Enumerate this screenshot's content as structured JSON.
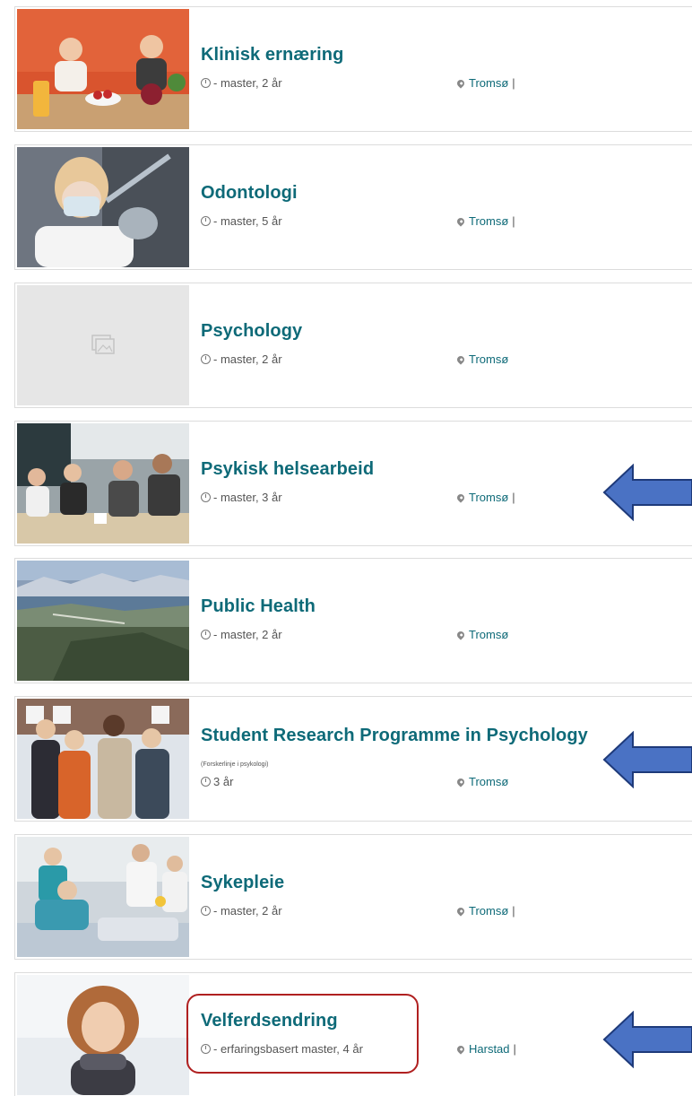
{
  "colors": {
    "title": "#0e6a78",
    "arrow": "#4a72c4",
    "highlight": "#b02020"
  },
  "programs": [
    {
      "title": "Klinisk ernæring",
      "meta": "- master, 2 år",
      "location": "Tromsø",
      "separator": "|"
    },
    {
      "title": "Odontologi",
      "meta": "- master, 5 år",
      "location": "Tromsø",
      "separator": "|"
    },
    {
      "title": "Psychology",
      "meta": "- master, 2 år",
      "location": "Tromsø",
      "separator": ""
    },
    {
      "title": "Psykisk helsearbeid",
      "meta": "- master, 3 år",
      "location": "Tromsø",
      "separator": "|"
    },
    {
      "title": "Public Health",
      "meta": "- master, 2 år",
      "location": "Tromsø",
      "separator": ""
    },
    {
      "title": "Student Research Programme in Psychology",
      "subtitle": "(Forskerlinje i psykologi)",
      "meta": "3 år",
      "location": "Tromsø",
      "separator": ""
    },
    {
      "title": "Sykepleie",
      "meta": "- master, 2 år",
      "location": "Tromsø",
      "separator": "|"
    },
    {
      "title": "Velferdsendring",
      "meta": "- erfaringsbasert master, 4 år",
      "location": "Harstad",
      "separator": "|"
    }
  ]
}
